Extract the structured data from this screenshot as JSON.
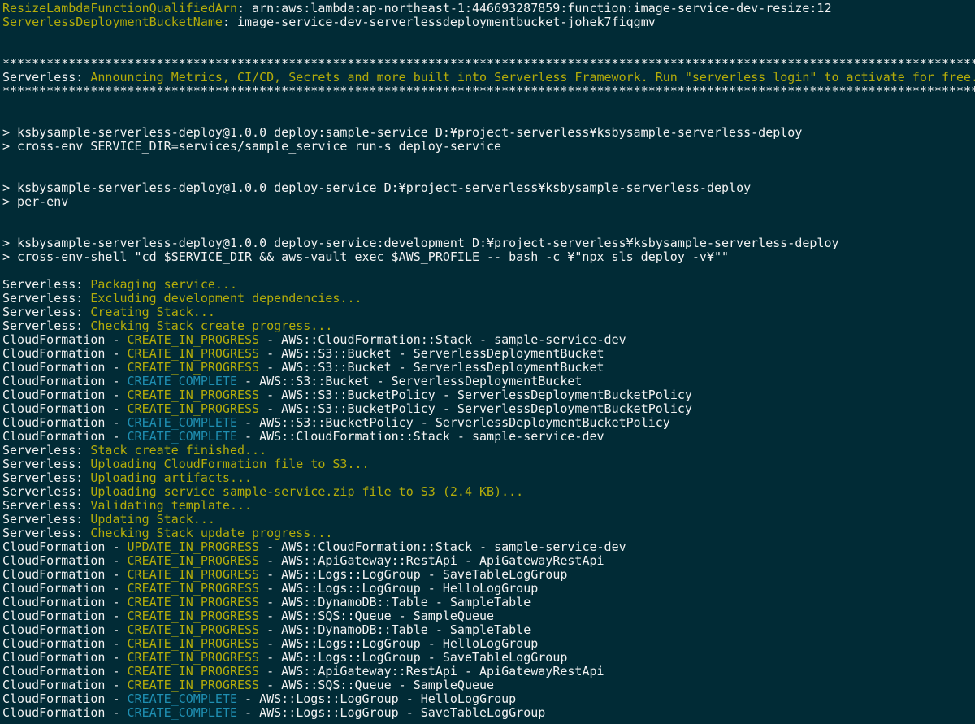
{
  "palette": {
    "background": "#012b36",
    "default_text": "#f2f2f2",
    "yellow": "#b4ac0a",
    "cyan": "#1f8fb2"
  },
  "terminal": {
    "lines": [
      [
        [
          "yellow",
          "ResizeLambdaFunctionQualifiedArn"
        ],
        [
          "white",
          ": arn:aws:lambda:ap-northeast-1:446693287859:function:image-service-dev-resize:12"
        ]
      ],
      [
        [
          "yellow",
          "ServerlessDeploymentBucketName"
        ],
        [
          "white",
          ": image-service-dev-serverlessdeploymentbucket-johek7fiqgmv"
        ]
      ],
      [],
      [],
      [
        [
          "white",
          "*******************************************************************************************************************************************"
        ]
      ],
      [
        [
          "white",
          "Serverless: "
        ],
        [
          "yellow",
          "Announcing Metrics, CI/CD, Secrets and more built into Serverless Framework. Run \"serverless login\" to activate for free.."
        ]
      ],
      [
        [
          "white",
          "*******************************************************************************************************************************************"
        ]
      ],
      [],
      [],
      [
        [
          "white",
          "> ksbysample-serverless-deploy@1.0.0 deploy:sample-service D:¥project-serverless¥ksbysample-serverless-deploy"
        ]
      ],
      [
        [
          "white",
          "> cross-env SERVICE_DIR=services/sample_service run-s deploy-service"
        ]
      ],
      [],
      [],
      [
        [
          "white",
          "> ksbysample-serverless-deploy@1.0.0 deploy-service D:¥project-serverless¥ksbysample-serverless-deploy"
        ]
      ],
      [
        [
          "white",
          "> per-env"
        ]
      ],
      [],
      [],
      [
        [
          "white",
          "> ksbysample-serverless-deploy@1.0.0 deploy-service:development D:¥project-serverless¥ksbysample-serverless-deploy"
        ]
      ],
      [
        [
          "white",
          "> cross-env-shell \"cd $SERVICE_DIR && aws-vault exec $AWS_PROFILE -- bash -c ¥\"npx sls deploy -v¥\"\""
        ]
      ],
      [],
      [
        [
          "white",
          "Serverless: "
        ],
        [
          "yellow",
          "Packaging service..."
        ]
      ],
      [
        [
          "white",
          "Serverless: "
        ],
        [
          "yellow",
          "Excluding development dependencies..."
        ]
      ],
      [
        [
          "white",
          "Serverless: "
        ],
        [
          "yellow",
          "Creating Stack..."
        ]
      ],
      [
        [
          "white",
          "Serverless: "
        ],
        [
          "yellow",
          "Checking Stack create progress..."
        ]
      ],
      [
        [
          "white",
          "CloudFormation - "
        ],
        [
          "yellow",
          "CREATE_IN_PROGRESS"
        ],
        [
          "white",
          " - AWS::CloudFormation::Stack - sample-service-dev"
        ]
      ],
      [
        [
          "white",
          "CloudFormation - "
        ],
        [
          "yellow",
          "CREATE_IN_PROGRESS"
        ],
        [
          "white",
          " - AWS::S3::Bucket - ServerlessDeploymentBucket"
        ]
      ],
      [
        [
          "white",
          "CloudFormation - "
        ],
        [
          "yellow",
          "CREATE_IN_PROGRESS"
        ],
        [
          "white",
          " - AWS::S3::Bucket - ServerlessDeploymentBucket"
        ]
      ],
      [
        [
          "white",
          "CloudFormation - "
        ],
        [
          "cyan",
          "CREATE_COMPLETE"
        ],
        [
          "white",
          " - AWS::S3::Bucket - ServerlessDeploymentBucket"
        ]
      ],
      [
        [
          "white",
          "CloudFormation - "
        ],
        [
          "yellow",
          "CREATE_IN_PROGRESS"
        ],
        [
          "white",
          " - AWS::S3::BucketPolicy - ServerlessDeploymentBucketPolicy"
        ]
      ],
      [
        [
          "white",
          "CloudFormation - "
        ],
        [
          "yellow",
          "CREATE_IN_PROGRESS"
        ],
        [
          "white",
          " - AWS::S3::BucketPolicy - ServerlessDeploymentBucketPolicy"
        ]
      ],
      [
        [
          "white",
          "CloudFormation - "
        ],
        [
          "cyan",
          "CREATE_COMPLETE"
        ],
        [
          "white",
          " - AWS::S3::BucketPolicy - ServerlessDeploymentBucketPolicy"
        ]
      ],
      [
        [
          "white",
          "CloudFormation - "
        ],
        [
          "cyan",
          "CREATE_COMPLETE"
        ],
        [
          "white",
          " - AWS::CloudFormation::Stack - sample-service-dev"
        ]
      ],
      [
        [
          "white",
          "Serverless: "
        ],
        [
          "yellow",
          "Stack create finished..."
        ]
      ],
      [
        [
          "white",
          "Serverless: "
        ],
        [
          "yellow",
          "Uploading CloudFormation file to S3..."
        ]
      ],
      [
        [
          "white",
          "Serverless: "
        ],
        [
          "yellow",
          "Uploading artifacts..."
        ]
      ],
      [
        [
          "white",
          "Serverless: "
        ],
        [
          "yellow",
          "Uploading service sample-service.zip file to S3 (2.4 KB)..."
        ]
      ],
      [
        [
          "white",
          "Serverless: "
        ],
        [
          "yellow",
          "Validating template..."
        ]
      ],
      [
        [
          "white",
          "Serverless: "
        ],
        [
          "yellow",
          "Updating Stack..."
        ]
      ],
      [
        [
          "white",
          "Serverless: "
        ],
        [
          "yellow",
          "Checking Stack update progress..."
        ]
      ],
      [
        [
          "white",
          "CloudFormation - "
        ],
        [
          "yellow",
          "UPDATE_IN_PROGRESS"
        ],
        [
          "white",
          " - AWS::CloudFormation::Stack - sample-service-dev"
        ]
      ],
      [
        [
          "white",
          "CloudFormation - "
        ],
        [
          "yellow",
          "CREATE_IN_PROGRESS"
        ],
        [
          "white",
          " - AWS::ApiGateway::RestApi - ApiGatewayRestApi"
        ]
      ],
      [
        [
          "white",
          "CloudFormation - "
        ],
        [
          "yellow",
          "CREATE_IN_PROGRESS"
        ],
        [
          "white",
          " - AWS::Logs::LogGroup - SaveTableLogGroup"
        ]
      ],
      [
        [
          "white",
          "CloudFormation - "
        ],
        [
          "yellow",
          "CREATE_IN_PROGRESS"
        ],
        [
          "white",
          " - AWS::Logs::LogGroup - HelloLogGroup"
        ]
      ],
      [
        [
          "white",
          "CloudFormation - "
        ],
        [
          "yellow",
          "CREATE_IN_PROGRESS"
        ],
        [
          "white",
          " - AWS::DynamoDB::Table - SampleTable"
        ]
      ],
      [
        [
          "white",
          "CloudFormation - "
        ],
        [
          "yellow",
          "CREATE_IN_PROGRESS"
        ],
        [
          "white",
          " - AWS::SQS::Queue - SampleQueue"
        ]
      ],
      [
        [
          "white",
          "CloudFormation - "
        ],
        [
          "yellow",
          "CREATE_IN_PROGRESS"
        ],
        [
          "white",
          " - AWS::DynamoDB::Table - SampleTable"
        ]
      ],
      [
        [
          "white",
          "CloudFormation - "
        ],
        [
          "yellow",
          "CREATE_IN_PROGRESS"
        ],
        [
          "white",
          " - AWS::Logs::LogGroup - HelloLogGroup"
        ]
      ],
      [
        [
          "white",
          "CloudFormation - "
        ],
        [
          "yellow",
          "CREATE_IN_PROGRESS"
        ],
        [
          "white",
          " - AWS::Logs::LogGroup - SaveTableLogGroup"
        ]
      ],
      [
        [
          "white",
          "CloudFormation - "
        ],
        [
          "yellow",
          "CREATE_IN_PROGRESS"
        ],
        [
          "white",
          " - AWS::ApiGateway::RestApi - ApiGatewayRestApi"
        ]
      ],
      [
        [
          "white",
          "CloudFormation - "
        ],
        [
          "yellow",
          "CREATE_IN_PROGRESS"
        ],
        [
          "white",
          " - AWS::SQS::Queue - SampleQueue"
        ]
      ],
      [
        [
          "white",
          "CloudFormation - "
        ],
        [
          "cyan",
          "CREATE_COMPLETE"
        ],
        [
          "white",
          " - AWS::Logs::LogGroup - HelloLogGroup"
        ]
      ],
      [
        [
          "white",
          "CloudFormation - "
        ],
        [
          "cyan",
          "CREATE_COMPLETE"
        ],
        [
          "white",
          " - AWS::Logs::LogGroup - SaveTableLogGroup"
        ]
      ]
    ]
  }
}
